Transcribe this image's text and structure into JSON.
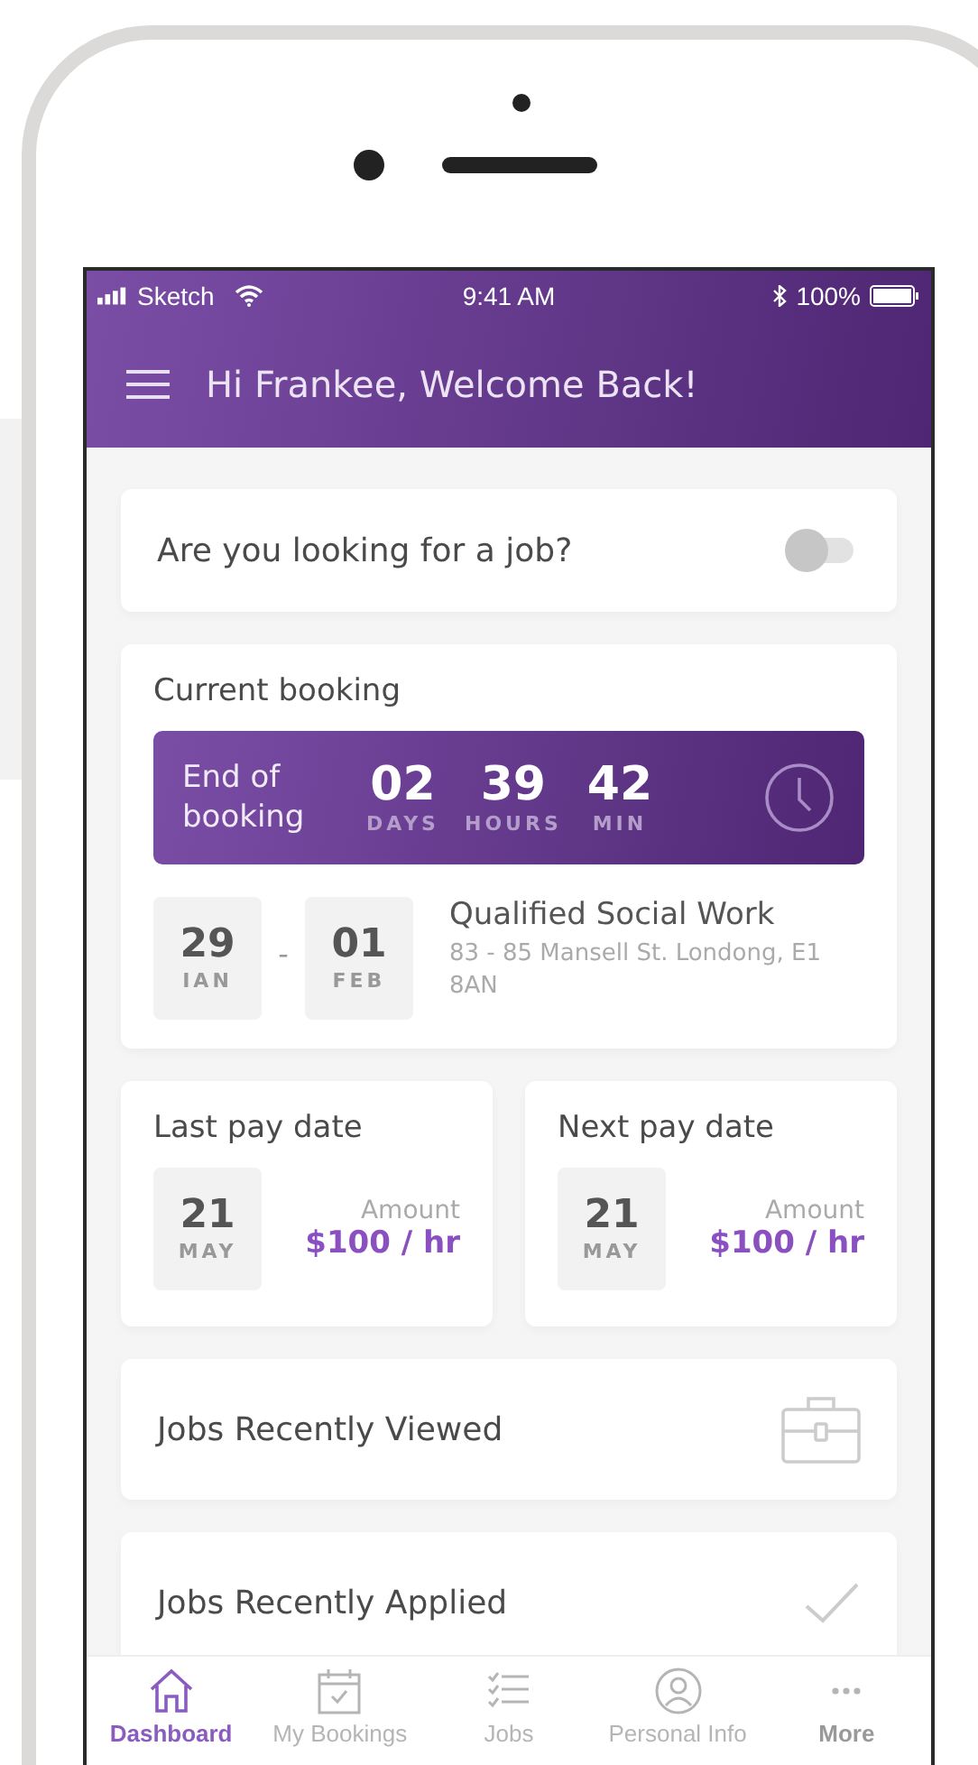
{
  "status_bar": {
    "carrier": "Sketch",
    "time": "9:41 AM",
    "battery": "100%"
  },
  "header": {
    "title": "Hi Frankee, Welcome Back!"
  },
  "job_search": {
    "label": "Are you looking for a job?",
    "on": false
  },
  "current_booking": {
    "title": "Current booking",
    "countdown_label": "End of booking",
    "countdown": [
      {
        "value": "02",
        "unit": "DAYS"
      },
      {
        "value": "39",
        "unit": "HOURS"
      },
      {
        "value": "42",
        "unit": "MIN"
      }
    ],
    "start": {
      "day": "29",
      "month": "IAN"
    },
    "separator": "-",
    "end": {
      "day": "01",
      "month": "FEB"
    },
    "job_title": "Qualified Social Work",
    "address": "83 - 85 Mansell St. Londong, E1 8AN"
  },
  "pay_dates": [
    {
      "title": "Last pay date",
      "day": "21",
      "month": "MAY",
      "amount_label": "Amount",
      "amount": "$100 / hr"
    },
    {
      "title": "Next pay date",
      "day": "21",
      "month": "MAY",
      "amount_label": "Amount",
      "amount": "$100 / hr"
    }
  ],
  "lists": [
    {
      "label": "Jobs Recently Viewed",
      "kind": "briefcase"
    },
    {
      "label": "Jobs Recently Applied",
      "kind": "check"
    }
  ],
  "tab_bar": [
    {
      "label": "Dashboard",
      "kind": "home",
      "selected": true
    },
    {
      "label": "My Bookings",
      "kind": "calendar",
      "selected": false
    },
    {
      "label": "Jobs",
      "kind": "list",
      "selected": false
    },
    {
      "label": "Personal Info",
      "kind": "person",
      "selected": false
    },
    {
      "label": "More",
      "kind": "more",
      "selected": false
    }
  ]
}
